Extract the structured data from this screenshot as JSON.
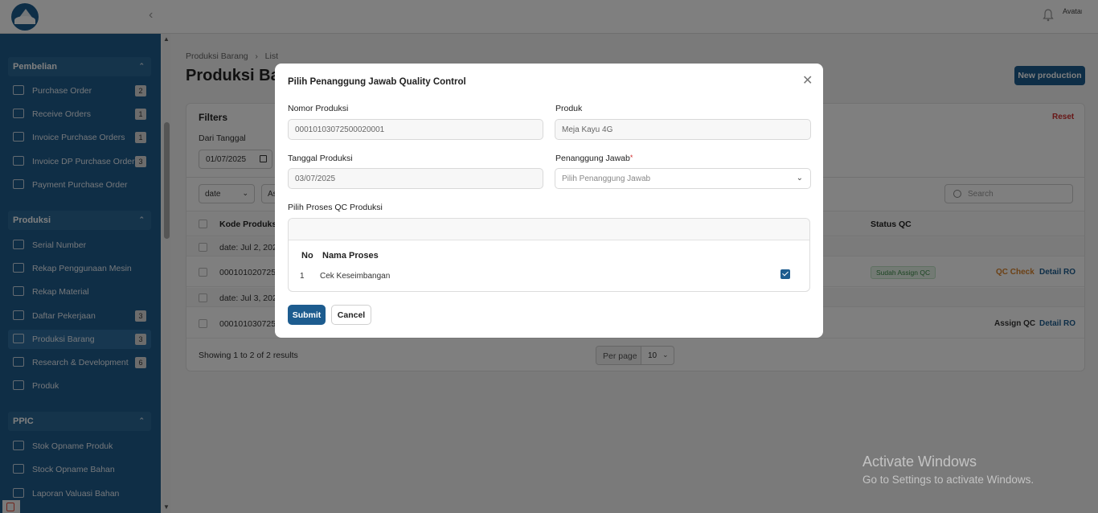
{
  "header": {
    "collapse_icon": "chevron-left-icon",
    "avatar_alt": "Avatar"
  },
  "sidebar": {
    "groups": [
      {
        "label": "Pembelian",
        "items": [
          {
            "label": "Purchase Order",
            "badge": "2",
            "icon": "truck-icon"
          },
          {
            "label": "Receive Orders",
            "badge": "1",
            "icon": "box-icon"
          },
          {
            "label": "Invoice Purchase Orders",
            "badge": "1",
            "icon": "box-icon"
          },
          {
            "label": "Invoice DP Purchase Order",
            "badge": "3",
            "icon": "box-icon"
          },
          {
            "label": "Payment Purchase Order",
            "badge": "",
            "icon": "box-icon"
          }
        ]
      },
      {
        "label": "Produksi",
        "items": [
          {
            "label": "Serial Number",
            "badge": "",
            "icon": "box-icon"
          },
          {
            "label": "Rekap Penggunaan Mesin",
            "badge": "",
            "icon": "box-icon"
          },
          {
            "label": "Rekap Material",
            "badge": "",
            "icon": "box-icon"
          },
          {
            "label": "Daftar Pekerjaan",
            "badge": "3",
            "icon": "box-icon"
          },
          {
            "label": "Produksi Barang",
            "badge": "3",
            "icon": "box-icon"
          },
          {
            "label": "Research & Development",
            "badge": "6",
            "icon": "rocket-icon"
          },
          {
            "label": "Produk",
            "badge": "",
            "icon": "cube-icon"
          }
        ]
      },
      {
        "label": "PPIC",
        "items": [
          {
            "label": "Stok Opname Produk",
            "badge": "",
            "icon": "box-icon"
          },
          {
            "label": "Stock Opname Bahan",
            "badge": "",
            "icon": "box-icon"
          },
          {
            "label": "Laporan Valuasi Bahan",
            "badge": "",
            "icon": "document-icon"
          }
        ]
      }
    ]
  },
  "page": {
    "breadcrumb": [
      "Produksi Barang",
      "List"
    ],
    "title": "Produksi Ba",
    "new_button": "New production",
    "filters": {
      "title": "Filters",
      "reset": "Reset",
      "dari_label": "Dari Tanggal",
      "dari_value": "01/07/2025"
    },
    "toolbar": {
      "sort_value": "date",
      "sort_dir": "As",
      "search_placeholder": "Search"
    },
    "table": {
      "col_kode": "Kode Produksi",
      "col_status": "Status QC",
      "groups": [
        {
          "label": "date: Jul 2, 202",
          "row_kode": "0001010207250",
          "status": "Sudah Assign QC",
          "action": "QC Check",
          "detail": "Detail RO"
        },
        {
          "label": "date: Jul 3, 202",
          "row_kode": "0001010307250",
          "status": "",
          "action": "Assign QC",
          "detail": "Detail RO"
        }
      ]
    },
    "showing": "Showing 1 to 2 of 2 results",
    "per_page_label": "Per page",
    "per_page_value": "10"
  },
  "modal": {
    "title": "Pilih Penanggung Jawab Quality Control",
    "nomor_label": "Nomor Produksi",
    "nomor_value": "00010103072500020001",
    "produk_label": "Produk",
    "produk_value": "Meja Kayu 4G",
    "tanggal_label": "Tanggal Produksi",
    "tanggal_value": "03/07/2025",
    "pj_label": "Penanggung Jawab",
    "pj_required": "*",
    "pj_placeholder": "Pilih Penanggung Jawab",
    "qc_label": "Pilih Proses QC Produksi",
    "qc_col_no": "No",
    "qc_col_name": "Nama Proses",
    "qc_rows": [
      {
        "no": "1",
        "name": "Cek Keseimbangan",
        "checked": true
      }
    ],
    "submit": "Submit",
    "cancel": "Cancel"
  },
  "watermark": {
    "line1": "Activate Windows",
    "line2": "Go to Settings to activate Windows."
  }
}
